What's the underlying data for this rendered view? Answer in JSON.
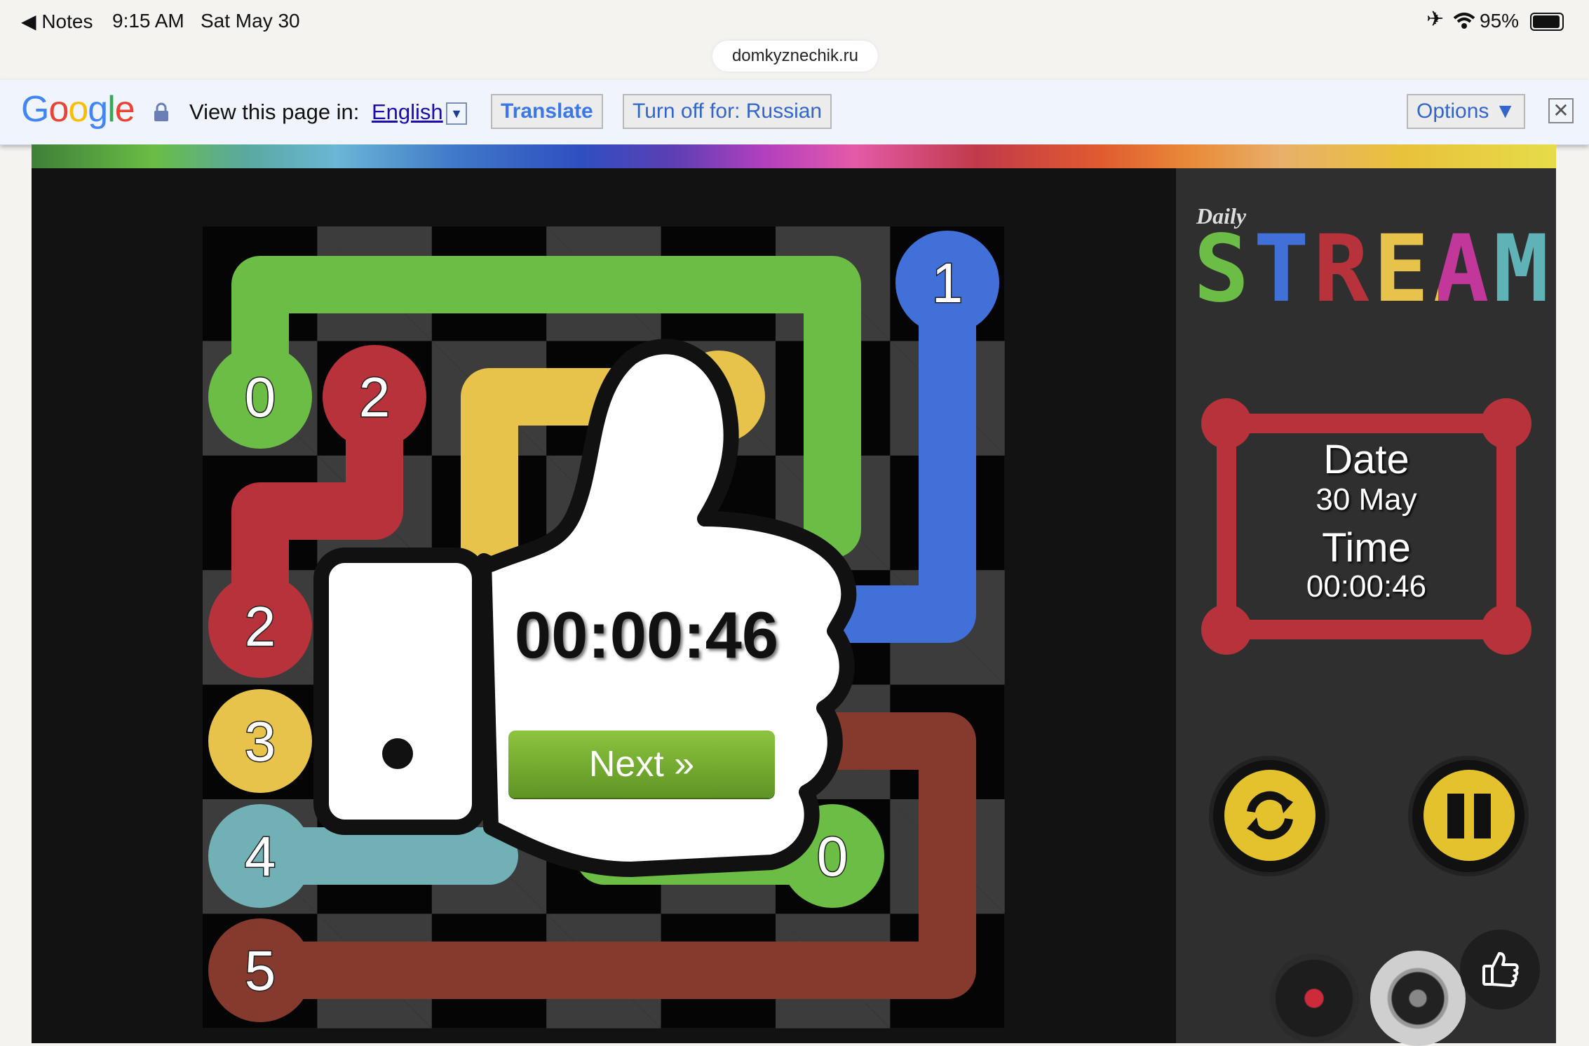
{
  "status_bar": {
    "back_app": "Notes",
    "time": "9:15 AM",
    "date": "Sat May 30",
    "battery": "95%"
  },
  "browser": {
    "url": "domkyznechik.ru"
  },
  "translate_bar": {
    "brand": "Google",
    "prompt": "View this page in:",
    "language": "English",
    "translate_label": "Translate",
    "turn_off_label": "Turn off for: Russian",
    "options_label": "Options ▼"
  },
  "game": {
    "logo_small": "Daily",
    "logo_big": "STREAM",
    "date_label": "Date",
    "date_value": "30 May",
    "time_label": "Time",
    "time_value": "00:00:46",
    "overlay_time": "00:00:46",
    "next_label": "Next »",
    "colors": {
      "green": "#6cbd45",
      "red": "#b8323c",
      "yellow": "#e7c34c",
      "blue": "#4270d9",
      "teal": "#71b1b6",
      "brown": "#853a2d",
      "next_button": "#77ae2f"
    },
    "endpoints": [
      {
        "color": "green",
        "label": "0"
      },
      {
        "color": "red",
        "label": "2"
      },
      {
        "color": "red",
        "label": "2"
      },
      {
        "color": "yellow",
        "label": "3"
      },
      {
        "color": "teal",
        "label": "4"
      },
      {
        "color": "brown",
        "label": "5"
      },
      {
        "color": "blue",
        "label": "1"
      },
      {
        "color": "green",
        "label": "0"
      }
    ],
    "controls": [
      "restart-icon",
      "pause-icon",
      "thumbs-up-icon",
      "record-icon",
      "speaker-icon"
    ]
  }
}
